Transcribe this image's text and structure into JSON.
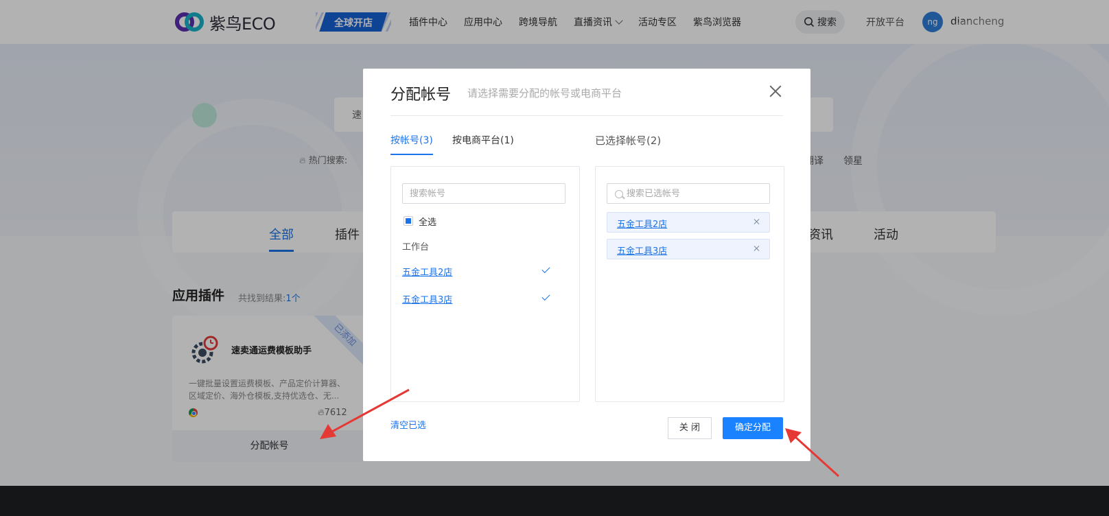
{
  "header": {
    "logo_text": "紫鸟ECO",
    "global_badge": "全球开店",
    "nav": [
      {
        "label": "插件中心"
      },
      {
        "label": "应用中心"
      },
      {
        "label": "跨境导航"
      },
      {
        "label": "直播资讯"
      },
      {
        "label": "活动专区"
      },
      {
        "label": "紫鸟浏览器"
      }
    ],
    "search_label": "搜索",
    "open_platform": "开放平台",
    "avatar_initials": "ng",
    "username": "diancheng"
  },
  "hero": {
    "search_text": "速",
    "hot_label": "热门搜索:",
    "hot_right": [
      "翻译",
      "领星"
    ]
  },
  "category_tabs": [
    "全部",
    "插件",
    "资讯",
    "活动"
  ],
  "section": {
    "title": "应用插件",
    "result_prefix": "共找到结果:",
    "result_count": "1个"
  },
  "card": {
    "title": "速卖通运费模板助手",
    "description": "一键批量设置运费模板、产品定价计算器、区域定价、海外仓模板,支持优选仓、无...",
    "hot_count": "7612",
    "ribbon": "已添加",
    "footer_button": "分配帐号"
  },
  "modal": {
    "title": "分配帐号",
    "subtitle": "请选择需要分配的帐号或电商平台",
    "tabs": [
      {
        "label": "按帐号(3)",
        "active": true
      },
      {
        "label": "按电商平台(1)",
        "active": false
      }
    ],
    "selected_header": "已选择帐号(2)",
    "left_search_placeholder": "搜索帐号",
    "select_all_label": "全选",
    "group_label": "工作台",
    "accounts": [
      {
        "name": "五金工具2店",
        "checked": true
      },
      {
        "name": "五金工具3店",
        "checked": true
      }
    ],
    "right_search_placeholder": "搜索已选帐号",
    "selected": [
      "五金工具2店",
      "五金工具3店"
    ],
    "clear_label": "清空已选",
    "close_button": "关 闭",
    "confirm_button": "确定分配"
  },
  "colors": {
    "primary": "#1a73e8",
    "confirm_button": "#1a82ff",
    "badge": "#1662d6",
    "annotation_arrow": "#e53935"
  }
}
